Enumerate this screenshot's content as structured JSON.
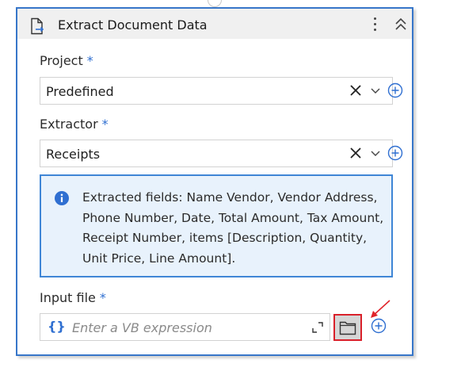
{
  "header": {
    "title": "Extract Document Data",
    "icons": [
      "document-export-icon",
      "kebab-menu-icon",
      "collapse-chevrons-icon"
    ]
  },
  "project": {
    "label": "Project",
    "required_mark": "*",
    "value": "Predefined"
  },
  "extractor": {
    "label": "Extractor",
    "required_mark": "*",
    "value": "Receipts"
  },
  "info": {
    "text": "Extracted fields: Name Vendor, Vendor Address, Phone Number, Date, Total Amount, Tax Amount, Receipt Number, items [Description, Quantity, Unit Price, Line Amount]."
  },
  "input_file": {
    "label": "Input file",
    "required_mark": "*",
    "brace": "{}",
    "placeholder": "Enter a VB expression"
  },
  "colors": {
    "accent": "#2f6fd1",
    "card_border": "#3776c9",
    "info_bg": "#e8f2fc",
    "highlight": "#d9202a"
  }
}
